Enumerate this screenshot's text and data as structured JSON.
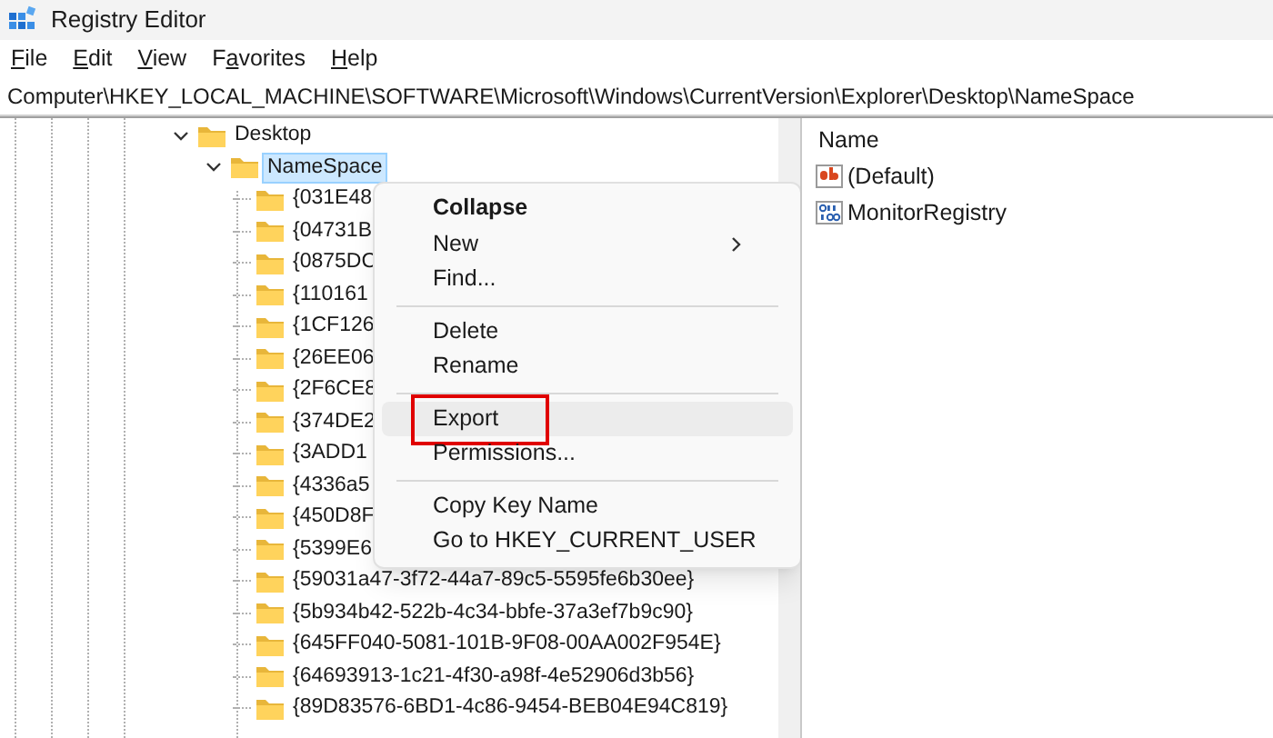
{
  "window": {
    "title": "Registry Editor"
  },
  "menu_bar": [
    {
      "key": "F",
      "post": "ile"
    },
    {
      "key": "E",
      "post": "dit"
    },
    {
      "key": "V",
      "post": "iew"
    },
    {
      "pre": "F",
      "key": "a",
      "post": "vorites"
    },
    {
      "key": "H",
      "post": "elp"
    }
  ],
  "address_bar": {
    "value": "Computer\\HKEY_LOCAL_MACHINE\\SOFTWARE\\Microsoft\\Windows\\CurrentVersion\\Explorer\\Desktop\\NameSpace"
  },
  "tree": [
    {
      "label": "Desktop",
      "expanded": true,
      "selected": false,
      "children": [
        {
          "label": "NameSpace",
          "expanded": true,
          "selected": true,
          "children": [
            {
              "label": "{031E48",
              "selected": false
            },
            {
              "label": "{04731B",
              "selected": false
            },
            {
              "label": "{0875DC",
              "selected": false
            },
            {
              "label": "{110161",
              "selected": false
            },
            {
              "label": "{1CF126",
              "selected": false
            },
            {
              "label": "{26EE06",
              "selected": false
            },
            {
              "label": "{2F6CE8",
              "selected": false
            },
            {
              "label": "{374DE2",
              "selected": false
            },
            {
              "label": "{3ADD1",
              "selected": false
            },
            {
              "label": "{4336a5",
              "selected": false
            },
            {
              "label": "{450D8F",
              "selected": false
            },
            {
              "label": "{5399E6",
              "selected": false
            },
            {
              "label": "{59031a47-3f72-44a7-89c5-5595fe6b30ee}",
              "selected": false
            },
            {
              "label": "{5b934b42-522b-4c34-bbfe-37a3ef7b9c90}",
              "selected": false
            },
            {
              "label": "{645FF040-5081-101B-9F08-00AA002F954E}",
              "selected": false
            },
            {
              "label": "{64693913-1c21-4f30-a98f-4e52906d3b56}",
              "selected": false
            },
            {
              "label": "{89D83576-6BD1-4c86-9454-BEB04E94C819}",
              "selected": false
            }
          ]
        }
      ]
    }
  ],
  "values": {
    "columns": [
      "Name"
    ],
    "rows": [
      {
        "name": "(Default)",
        "kind": "string"
      },
      {
        "name": "MonitorRegistry",
        "kind": "binary"
      }
    ]
  },
  "context_menu": [
    {
      "kind": "item",
      "label": "Collapse",
      "default": true,
      "selected": false,
      "annotated": false
    },
    {
      "kind": "submenu",
      "label": "New",
      "default": false,
      "selected": false,
      "annotated": false
    },
    {
      "kind": "item",
      "label": "Find...",
      "default": false,
      "selected": false,
      "annotated": false
    },
    {
      "kind": "separator"
    },
    {
      "kind": "item",
      "label": "Delete",
      "default": false,
      "selected": false,
      "annotated": false
    },
    {
      "kind": "item",
      "label": "Rename",
      "default": false,
      "selected": false,
      "annotated": false
    },
    {
      "kind": "separator"
    },
    {
      "kind": "item",
      "label": "Export",
      "default": false,
      "selected": true,
      "annotated": true
    },
    {
      "kind": "item",
      "label": "Permissions...",
      "default": false,
      "selected": false,
      "annotated": false
    },
    {
      "kind": "separator"
    },
    {
      "kind": "item",
      "label": "Copy Key Name",
      "default": false,
      "selected": false,
      "annotated": false
    },
    {
      "kind": "item",
      "label": "Go to HKEY_CURRENT_USER",
      "default": false,
      "selected": false,
      "annotated": false
    }
  ]
}
